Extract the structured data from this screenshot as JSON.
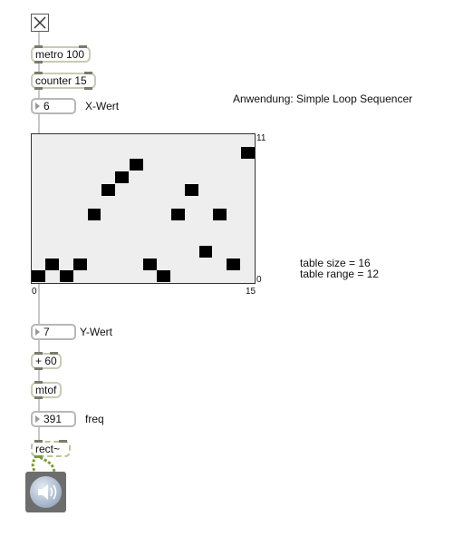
{
  "toggle": {
    "checked": true
  },
  "objects": {
    "metro": "metro 100",
    "counter": "counter 15",
    "plus": "+ 60",
    "mtof": "mtof",
    "rect": "rect~"
  },
  "number_boxes": {
    "x": {
      "value": "6",
      "label": "X-Wert"
    },
    "y": {
      "value": "7",
      "label": "Y-Wert"
    },
    "freq": {
      "value": "391",
      "label": "freq"
    }
  },
  "title": "Anwendung: Simple Loop Sequencer",
  "table": {
    "x_min": "0",
    "x_max": "15",
    "y_min": "0",
    "y_max": "11",
    "info_size": "table size = 16",
    "info_range": "table range = 12",
    "values": [
      0,
      1,
      0,
      1,
      5,
      7,
      8,
      9,
      1,
      0,
      5,
      7,
      2,
      5,
      1,
      10
    ]
  },
  "icons": {
    "toggle": "toggle-x-icon",
    "dac": "speaker-icon"
  }
}
